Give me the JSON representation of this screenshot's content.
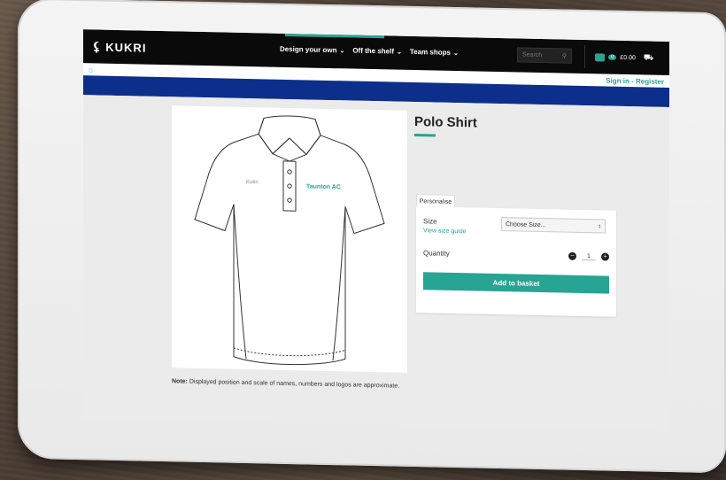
{
  "header": {
    "logo_text": "KUKRI",
    "nav": [
      "Design your own",
      "Off the shelf",
      "Team shops"
    ],
    "search_placeholder": "Search",
    "basket_count": "0",
    "basket_total": "£0.00"
  },
  "crumbbar": {
    "signin": "Sign in - Register"
  },
  "product": {
    "title": "Polo Shirt",
    "shirt_brand": "Kukri",
    "shirt_logo": "Taunton AC",
    "note_bold": "Note:",
    "note_text": " Displayed position and scale of names, numbers and logos are approximate."
  },
  "panel": {
    "tab": "Personalise",
    "size_label": "Size",
    "size_guide": "View size guide",
    "size_select": "Choose Size...",
    "quantity_label": "Quantity",
    "quantity_value": "1",
    "add_button": "Add to basket"
  },
  "colors": {
    "accent": "#27a493",
    "brand_blue": "#0d2f8c",
    "topbar": "#0a0a0a"
  }
}
